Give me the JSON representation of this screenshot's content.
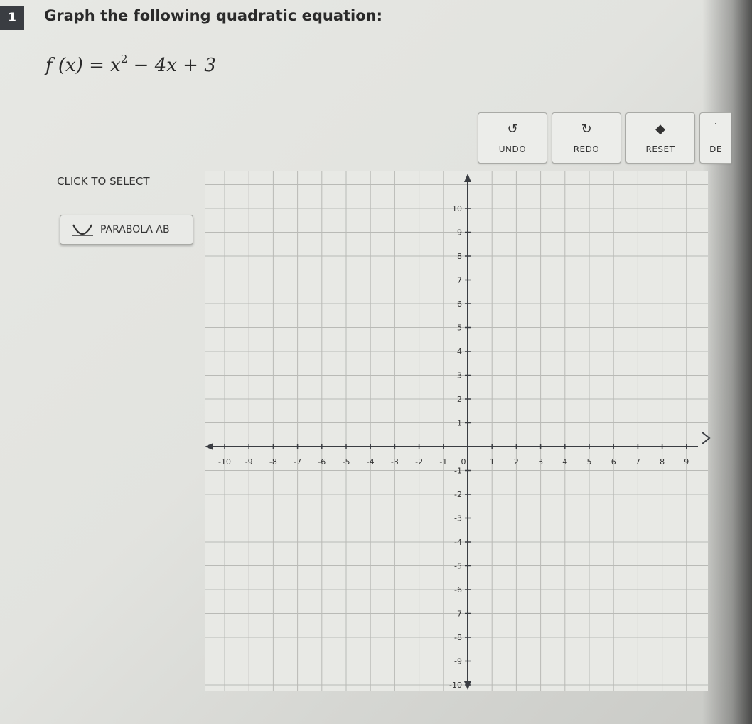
{
  "question": {
    "number": "1",
    "prompt": "Graph the following quadratic equation:",
    "equation_lhs": "f (x) = x",
    "equation_exp": "2",
    "equation_rhs": " − 4x + 3"
  },
  "toolbar": {
    "undo_label": "UNDO",
    "redo_label": "REDO",
    "reset_label": "RESET",
    "partial_label": "DE"
  },
  "sidebar": {
    "select_label": "CLICK TO SELECT",
    "parabola_label": "PARABOLA AB"
  },
  "graph": {
    "xmin": -10,
    "xmax": 10,
    "ymin": -10,
    "ymax": 10,
    "x_ticks_labeled": [
      -10,
      -9,
      -8,
      -7,
      -6,
      -5,
      -4,
      -3,
      -2,
      -1,
      1,
      2,
      3,
      4,
      5,
      6,
      7,
      8,
      9
    ],
    "y_ticks_labeled": [
      10,
      9,
      8,
      7,
      6,
      5,
      4,
      3,
      2,
      1,
      -1,
      -2,
      -3,
      -4,
      -5,
      -6,
      -7,
      -8,
      -9,
      -10
    ],
    "origin_label": "0",
    "axis_color": "#3a3d42",
    "grid_color": "#b9bab6"
  }
}
